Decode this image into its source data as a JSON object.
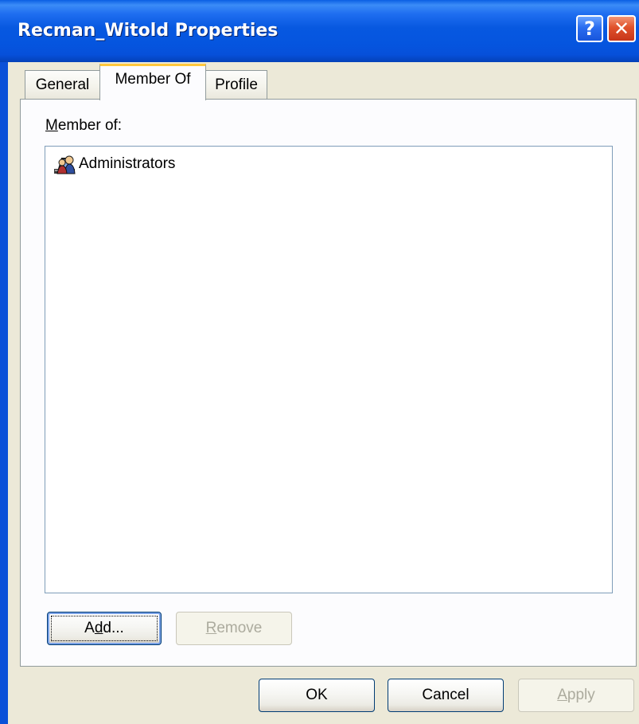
{
  "window": {
    "title": "Recman_Witold Properties",
    "help_glyph": "?",
    "close_glyph": "✕"
  },
  "tabs": [
    {
      "label": "General",
      "active": false
    },
    {
      "label": "Member Of",
      "active": true
    },
    {
      "label": "Profile",
      "active": false
    }
  ],
  "member_of": {
    "label_mnemonic": "M",
    "label_rest": "ember of:",
    "items": [
      {
        "label": "Administrators",
        "icon": "group-icon"
      }
    ]
  },
  "panel_buttons": {
    "add": {
      "pre": "A",
      "mnemonic": "d",
      "post": "d...",
      "enabled": true
    },
    "remove": {
      "pre": "",
      "mnemonic": "R",
      "post": "emove",
      "enabled": false
    }
  },
  "dialog_buttons": {
    "ok": {
      "label": "OK",
      "enabled": true
    },
    "cancel": {
      "label": "Cancel",
      "enabled": true
    },
    "apply": {
      "pre": "",
      "mnemonic": "A",
      "post": "pply",
      "enabled": false
    }
  },
  "colors": {
    "titlebar": "#0555df",
    "dialog_face": "#ece9d8",
    "active_tab_highlight": "#ffc83c",
    "close_button": "#e0512b",
    "listbox_border": "#7f9db9"
  }
}
